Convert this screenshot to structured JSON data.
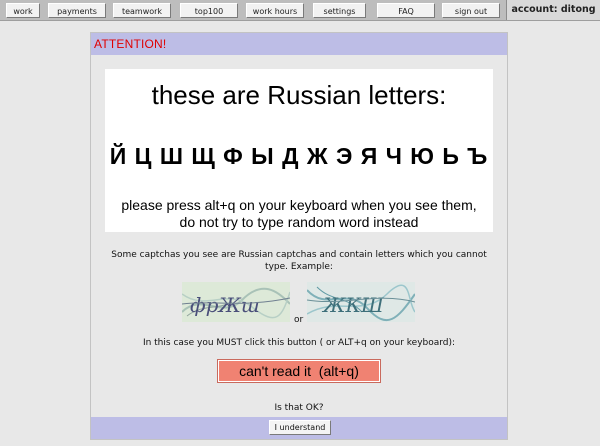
{
  "nav": {
    "items": [
      "work",
      "payments",
      "teamwork",
      "top100",
      "work hours",
      "settings",
      "FAQ",
      "sign out"
    ],
    "account_label": "account: ditong"
  },
  "panel": {
    "attention": "ATTENTION!",
    "title": "these are Russian letters:",
    "letters": "Й Ц Ш Щ Ф Ы Д Ж Э Я Ч Ю Ь Ъ",
    "instruction_line1": "please press alt+q on your keyboard when you see them,",
    "instruction_line2": "do not try to type random word instead",
    "info_line1": "Some captchas you see are Russian captchas and contain letters which you cannot",
    "info_line2": "type. Example:",
    "or_label": "or",
    "must_text": "In this case you MUST click this button ( or ALT+q on your keyboard):",
    "cant_read_label": "can't read it  (alt+q)",
    "ok_question": "Is that OK?",
    "understand_label": "I understand"
  },
  "colors": {
    "attention": "#e00000",
    "header_band": "#bdbde6",
    "cant_read_button": "#f08272"
  },
  "icons": {
    "captcha1": "captcha-example-image",
    "captcha2": "captcha-example-image"
  }
}
